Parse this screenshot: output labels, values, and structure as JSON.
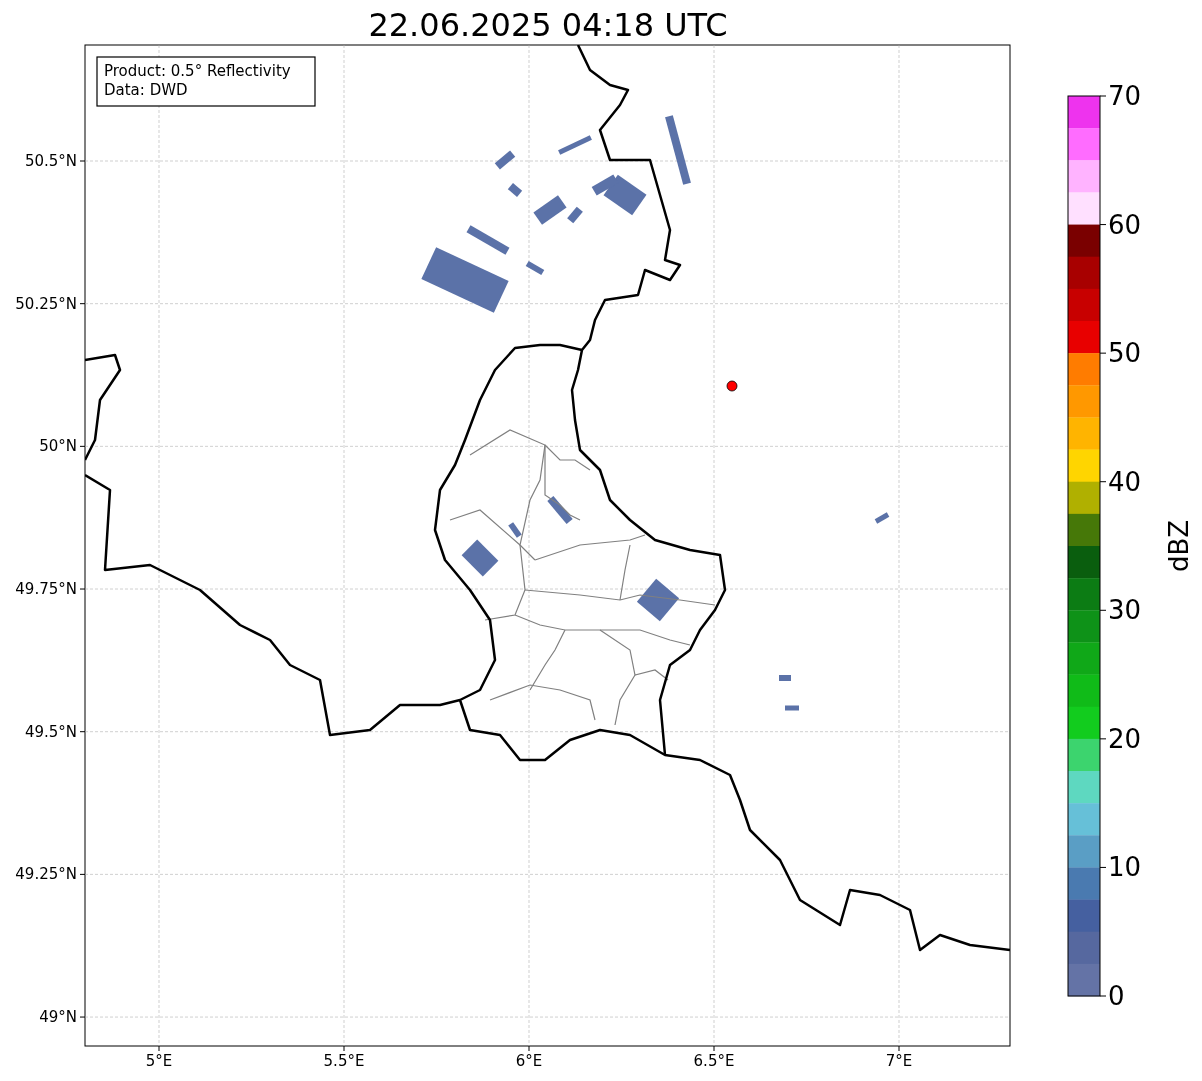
{
  "title": "22.06.2025 04:18 UTC",
  "info_box": {
    "lines": [
      "Product: 0.5° Reflectivity",
      "Data: DWD"
    ]
  },
  "map": {
    "lon_ticks": [
      "5°E",
      "5.5°E",
      "6°E",
      "6.5°E",
      "7°E"
    ],
    "lat_ticks": [
      "50.5°N",
      "50.25°N",
      "50°N",
      "49.75°N",
      "49.5°N",
      "49.25°N",
      "49°N"
    ]
  },
  "colorbar": {
    "label": "dBZ",
    "ticks": [
      "70",
      "60",
      "50",
      "40",
      "30",
      "20",
      "10",
      "0"
    ],
    "bands": [
      {
        "color": "#ee33ee"
      },
      {
        "color": "#ff6cff"
      },
      {
        "color": "#ffb3ff"
      },
      {
        "color": "#ffe0ff"
      },
      {
        "color": "#7a0000"
      },
      {
        "color": "#a80000"
      },
      {
        "color": "#c80000"
      },
      {
        "color": "#e80000"
      },
      {
        "color": "#ff7c00"
      },
      {
        "color": "#ff9800"
      },
      {
        "color": "#ffb400"
      },
      {
        "color": "#ffd500"
      },
      {
        "color": "#b0b000"
      },
      {
        "color": "#467808"
      },
      {
        "color": "#0a5e0e"
      },
      {
        "color": "#0c7c14"
      },
      {
        "color": "#0e9218"
      },
      {
        "color": "#10a818"
      },
      {
        "color": "#10bb18"
      },
      {
        "color": "#12cc1e"
      },
      {
        "color": "#3cd46e"
      },
      {
        "color": "#5ed8c0"
      },
      {
        "color": "#66c0d8"
      },
      {
        "color": "#5a9ec5"
      },
      {
        "color": "#4a7ab0"
      },
      {
        "color": "#4560a0"
      },
      {
        "color": "#56689f"
      },
      {
        "color": "#6473a6"
      }
    ]
  }
}
